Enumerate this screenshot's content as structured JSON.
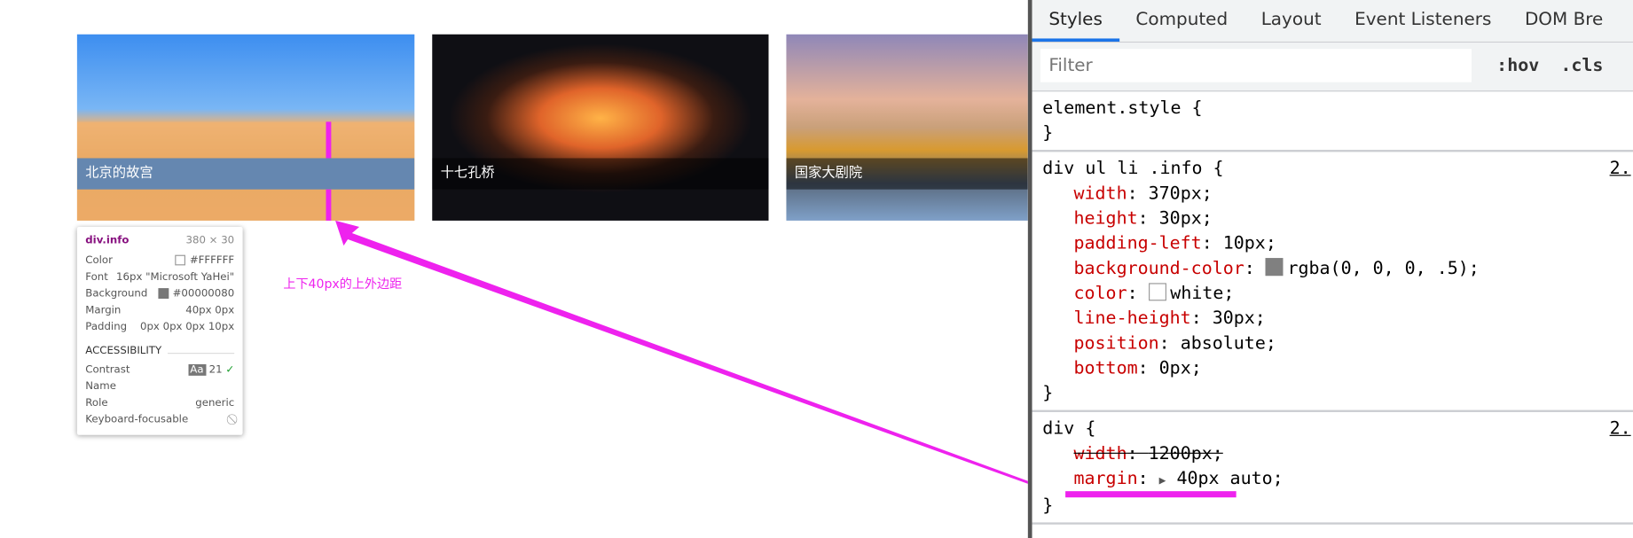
{
  "gallery": [
    {
      "caption": "北京的故宫"
    },
    {
      "caption": "十七孔桥"
    },
    {
      "caption": "国家大剧院"
    }
  ],
  "tooltip": {
    "selector": "div.info",
    "size": "380 × 30",
    "rows": [
      {
        "label": "Color",
        "value": "#FFFFFF"
      },
      {
        "label": "Font",
        "value": "16px \"Microsoft YaHei\""
      },
      {
        "label": "Background",
        "value": "#00000080"
      },
      {
        "label": "Margin",
        "value": "40px 0px"
      },
      {
        "label": "Padding",
        "value": "0px 0px 0px 10px"
      }
    ],
    "accessibility_title": "ACCESSIBILITY",
    "contrast_label": "Contrast",
    "contrast_badge": "Aa",
    "contrast_value": "21",
    "name_label": "Name",
    "role_label": "Role",
    "role_value": "generic",
    "focus_label": "Keyboard-focusable"
  },
  "annotation": "上下40px的上外边距",
  "annotation_color": "#EE22EE",
  "devtools": {
    "tabs": [
      "Styles",
      "Computed",
      "Layout",
      "Event Listeners",
      "DOM Bre"
    ],
    "filter_placeholder": "Filter",
    "hov": ":hov",
    "cls": ".cls",
    "rules": [
      {
        "selector": "element.style {",
        "props": [],
        "close": "}"
      },
      {
        "selector": "div ul li .info {",
        "source": "2.",
        "props": [
          {
            "name": "width",
            "value": "370px;"
          },
          {
            "name": "height",
            "value": "30px;"
          },
          {
            "name": "padding-left",
            "value": "10px;"
          },
          {
            "name": "background-color",
            "value": "rgba(0, 0, 0, .5);",
            "swatch": "#808080"
          },
          {
            "name": "color",
            "value": "white;",
            "swatch": "#ffffff"
          },
          {
            "name": "line-height",
            "value": "30px;"
          },
          {
            "name": "position",
            "value": "absolute;"
          },
          {
            "name": "bottom",
            "value": "0px;"
          }
        ],
        "close": "}"
      },
      {
        "selector": "div {",
        "source": "2.",
        "props": [
          {
            "name": "width",
            "value": "1200px;",
            "struck": true
          },
          {
            "name": "margin",
            "value": "40px auto;",
            "expander": true
          }
        ],
        "close": "}"
      }
    ]
  }
}
